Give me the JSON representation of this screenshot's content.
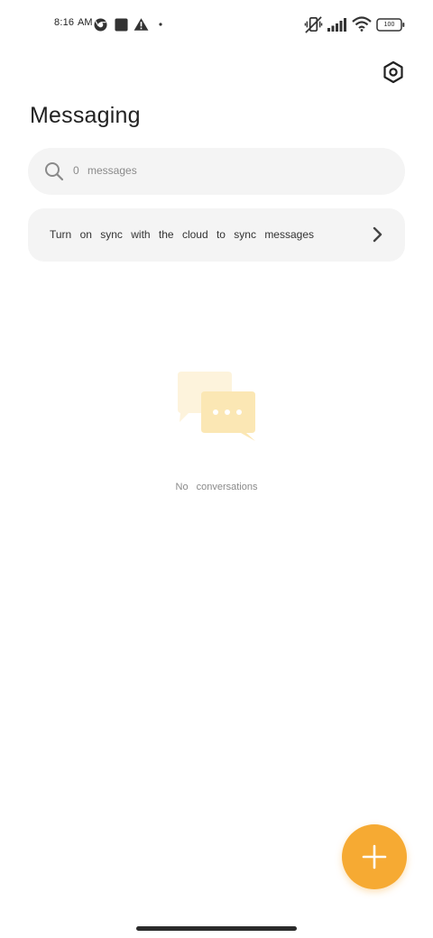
{
  "status_bar": {
    "time": "8:16",
    "ampm": "AM",
    "battery_level": "100",
    "icons": [
      "chrome-icon",
      "square-app-icon",
      "alert-triangle-icon",
      "dot-icon",
      "vibrate-mute-icon",
      "signal-icon",
      "wifi-icon",
      "battery-icon"
    ]
  },
  "header": {
    "title": "Messaging",
    "settings_icon": "settings-hexagon-icon"
  },
  "search": {
    "placeholder": "0 messages",
    "icon": "search-icon"
  },
  "sync_banner": {
    "text": "Turn on sync with the cloud to sync messages",
    "icon": "chevron-right-icon"
  },
  "empty_state": {
    "illustration": "chat-bubbles-icon",
    "text": "No conversations"
  },
  "fab": {
    "icon": "plus-icon"
  },
  "colors": {
    "accent": "#f6aa33",
    "surface": "#f4f4f4",
    "bubble_light": "#fdf3dc",
    "bubble_dark": "#fbe7b4"
  }
}
